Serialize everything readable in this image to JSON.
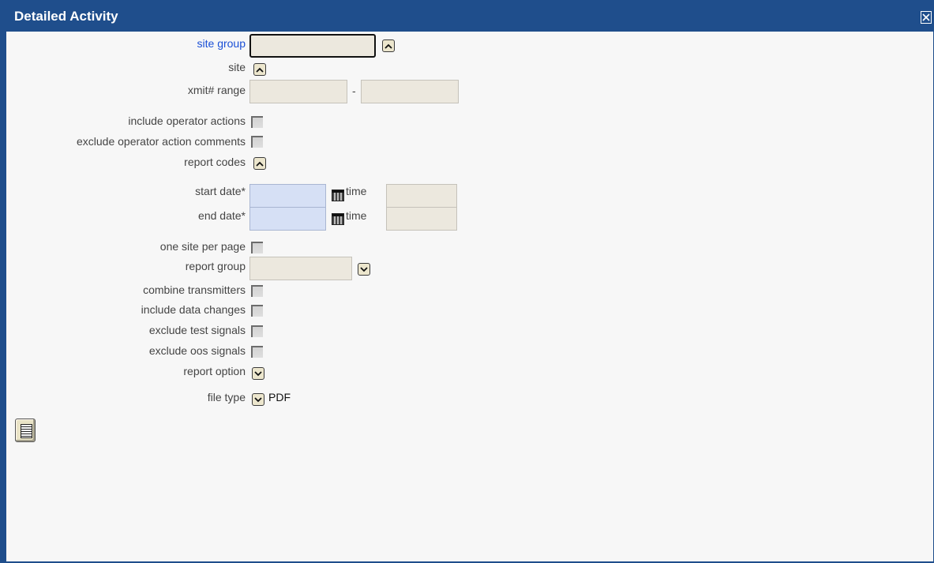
{
  "window": {
    "title": "Detailed Activity"
  },
  "form": {
    "site_group_label": "site group",
    "site_label": "site",
    "xmit_range_label": "xmit# range",
    "xmit_range_sep": "-",
    "include_operator_actions_label": "include operator actions",
    "exclude_operator_action_comments_label": "exclude operator action comments",
    "report_codes_label": "report codes",
    "start_date_label": "start date*",
    "end_date_label": "end date*",
    "time_label": "time",
    "one_site_per_page_label": "one site per page",
    "report_group_label": "report group",
    "combine_transmitters_label": "combine transmitters",
    "include_data_changes_label": "include data changes",
    "exclude_test_signals_label": "exclude test signals",
    "exclude_oos_signals_label": "exclude oos signals",
    "report_option_label": "report option",
    "file_type_label": "file type",
    "file_type_value": "PDF"
  },
  "icons": {
    "close": "close-icon",
    "expand_up": "chevron-up-icon",
    "expand_down": "chevron-down-icon",
    "calendar": "calendar-icon",
    "report": "report-icon"
  },
  "colors": {
    "titlebar": "#1f4e8c",
    "link_label": "#1a4fd6",
    "date_input": "#d6e0f5",
    "input": "#ece8de"
  }
}
